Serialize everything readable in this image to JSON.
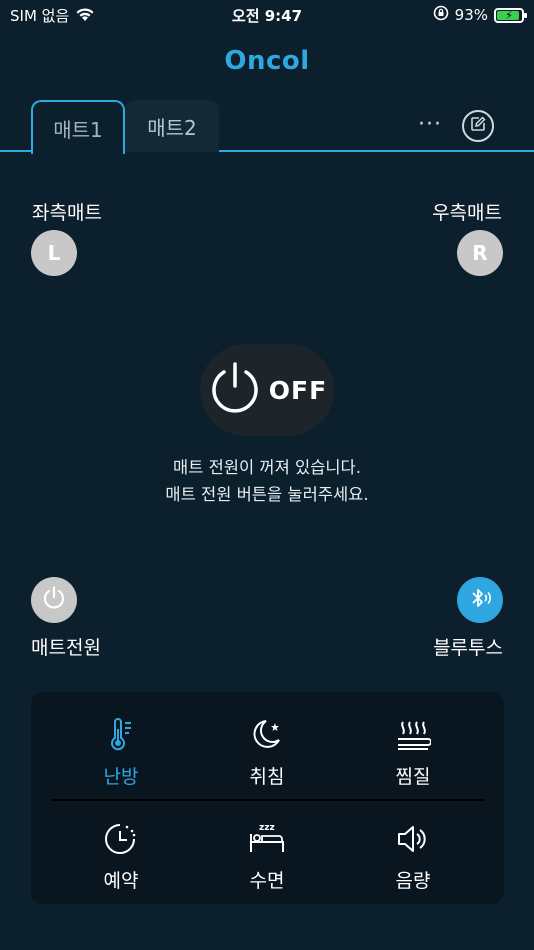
{
  "status_bar": {
    "carrier": "SIM 없음",
    "time": "오전 9:47",
    "battery_percent": "93%"
  },
  "app": {
    "brand": "Oncol"
  },
  "tabs": [
    {
      "label": "매트1",
      "active": true
    },
    {
      "label": "매트2",
      "active": false
    }
  ],
  "more_label": "···",
  "mats": {
    "left": {
      "label": "좌측매트",
      "badge": "L"
    },
    "right": {
      "label": "우측매트",
      "badge": "R"
    }
  },
  "power": {
    "state": "OFF",
    "message_line1": "매트 전원이 꺼져 있습니다.",
    "message_line2": "매트 전원 버튼을 눌러주세요."
  },
  "controls": {
    "power_label": "매트전원",
    "bluetooth_label": "블루투스"
  },
  "modes": [
    {
      "label": "난방",
      "icon": "thermometer-icon",
      "active": true
    },
    {
      "label": "취침",
      "icon": "moon-star-icon",
      "active": false
    },
    {
      "label": "찜질",
      "icon": "steam-icon",
      "active": false
    },
    {
      "label": "예약",
      "icon": "clock-icon",
      "active": false
    },
    {
      "label": "수면",
      "icon": "sleep-bed-icon",
      "active": false
    },
    {
      "label": "음량",
      "icon": "speaker-icon",
      "active": false
    }
  ],
  "colors": {
    "accent": "#2fa7e0",
    "background": "#0c1f2c",
    "panel": "#09161f"
  }
}
